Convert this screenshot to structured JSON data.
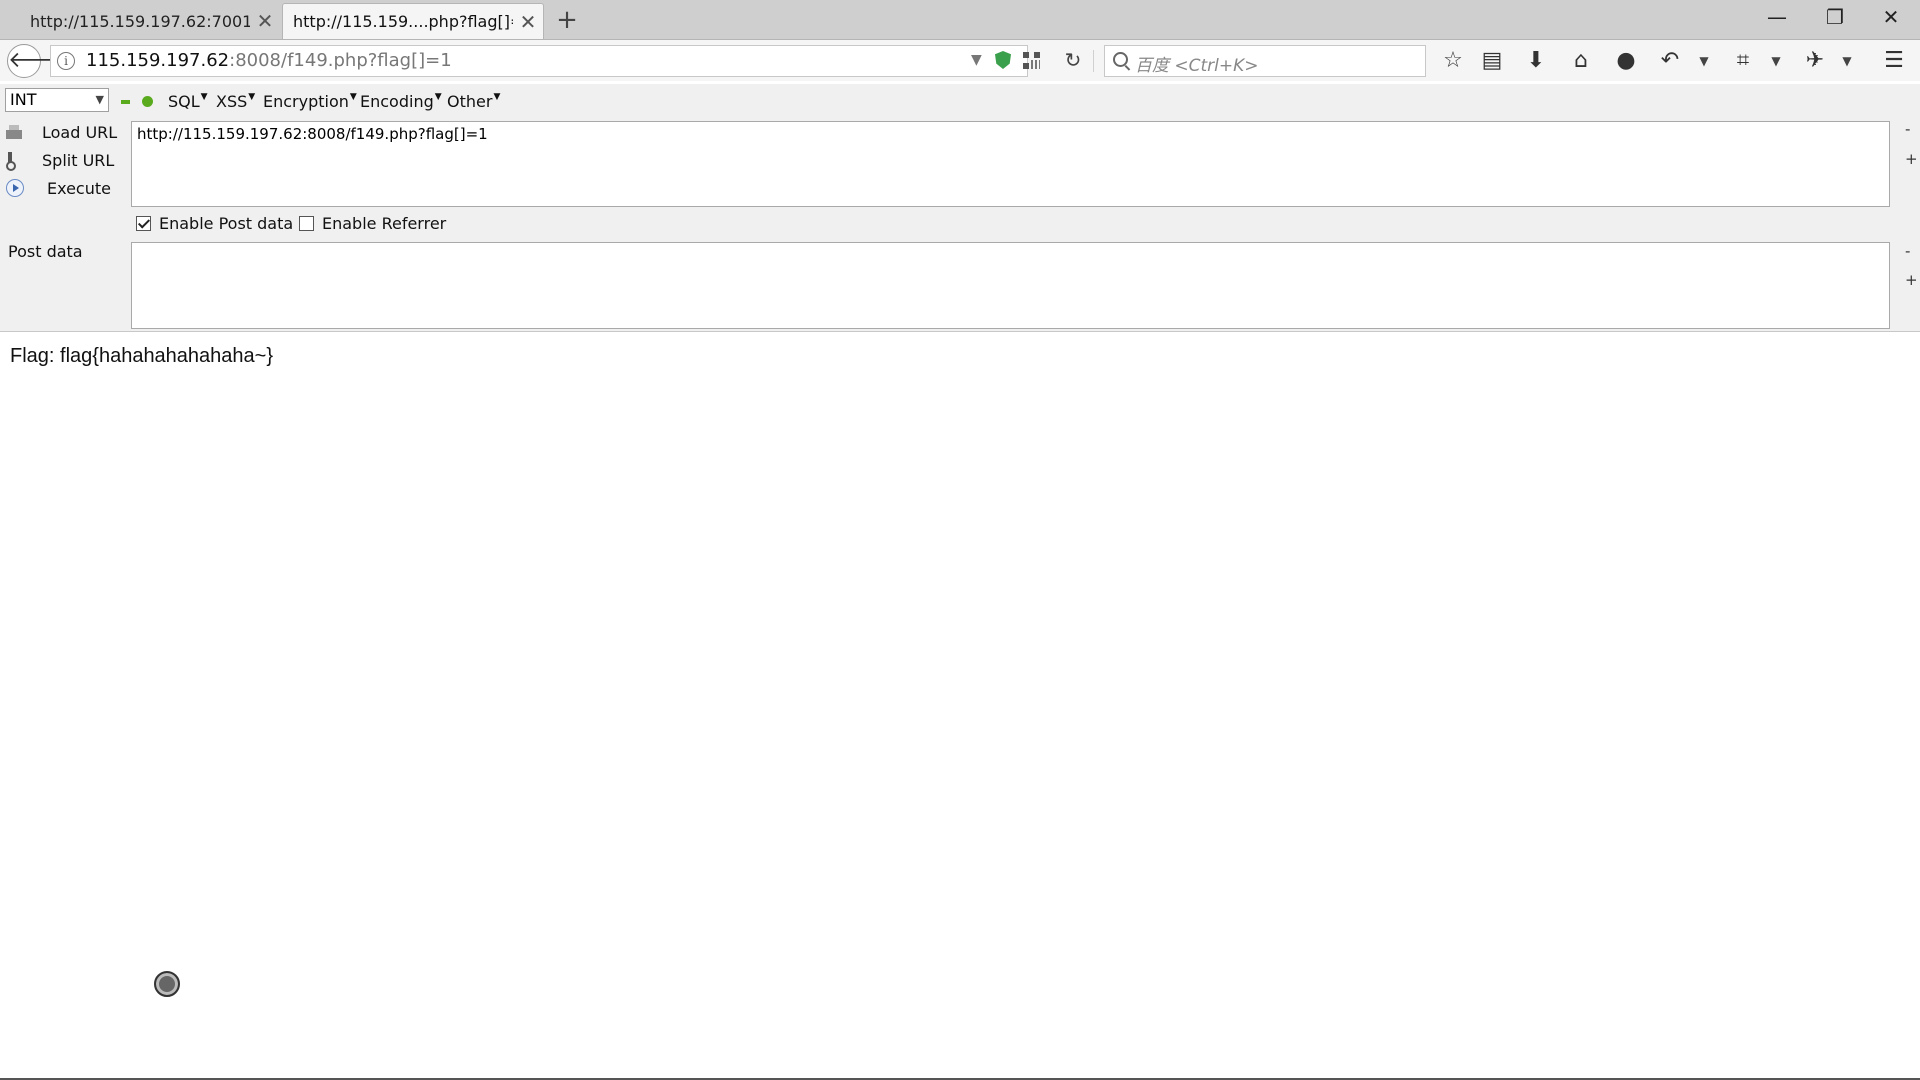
{
  "tabs": [
    {
      "title": "http://115.159.197.62:7001/",
      "active": false
    },
    {
      "title": "http://115.159....php?flag[]=1",
      "active": true
    }
  ],
  "new_tab_symbol": "+",
  "window_controls": {
    "minimize": "—",
    "restore": "❐",
    "close": "✕"
  },
  "navbar": {
    "url_host": "115.159.197.62",
    "url_path": ":8008/f149.php?flag[]=1",
    "search_placeholder": "百度 <Ctrl+K>",
    "icons": [
      "back-arrow-icon",
      "info-icon",
      "shield-icon",
      "qr-code-icon",
      "reload-icon",
      "search-icon",
      "bookmark-star-icon",
      "reading-list-icon",
      "download-icon",
      "home-icon",
      "chat-icon",
      "undo-icon",
      "screenshot-icon",
      "extension-icon",
      "menu-icon"
    ]
  },
  "hackbar": {
    "select_value": "INT",
    "menus": [
      "SQL",
      "XSS",
      "Encryption",
      "Encoding",
      "Other"
    ],
    "actions": {
      "load": "Load URL",
      "split": "Split URL",
      "execute": "Execute"
    },
    "url_value": "http://115.159.197.62:8008/f149.php?flag[]=1",
    "enable_post_label": "Enable Post data",
    "enable_post_checked": true,
    "enable_referrer_label": "Enable Referrer",
    "enable_referrer_checked": false,
    "post_label": "Post data",
    "post_value": "",
    "minus": "-",
    "plus": "+"
  },
  "page": {
    "flag_text": "Flag: flag{hahahahahahaha~}"
  },
  "colors": {
    "accent_green": "#5aaa1e",
    "shield_green": "#3aa04c"
  }
}
